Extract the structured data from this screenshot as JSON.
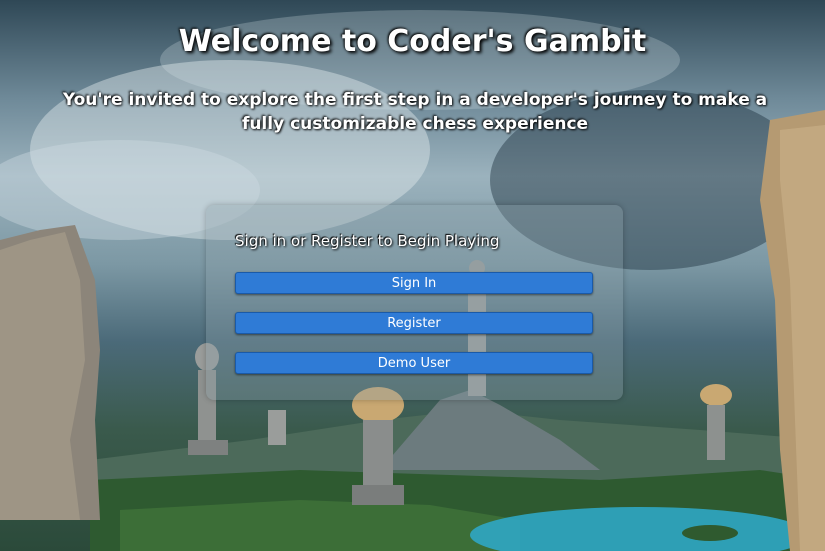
{
  "header": {
    "title": "Welcome to Coder's Gambit",
    "subtitle": "You're invited to explore the first step in a developer's journey to make a fully customizable chess experience"
  },
  "auth_panel": {
    "heading": "Sign in or Register to Begin Playing",
    "sign_in_label": "Sign In",
    "register_label": "Register",
    "demo_label": "Demo User"
  },
  "colors": {
    "button": "#2f7bd6",
    "panel": "rgba(140,160,170,0.35)"
  }
}
